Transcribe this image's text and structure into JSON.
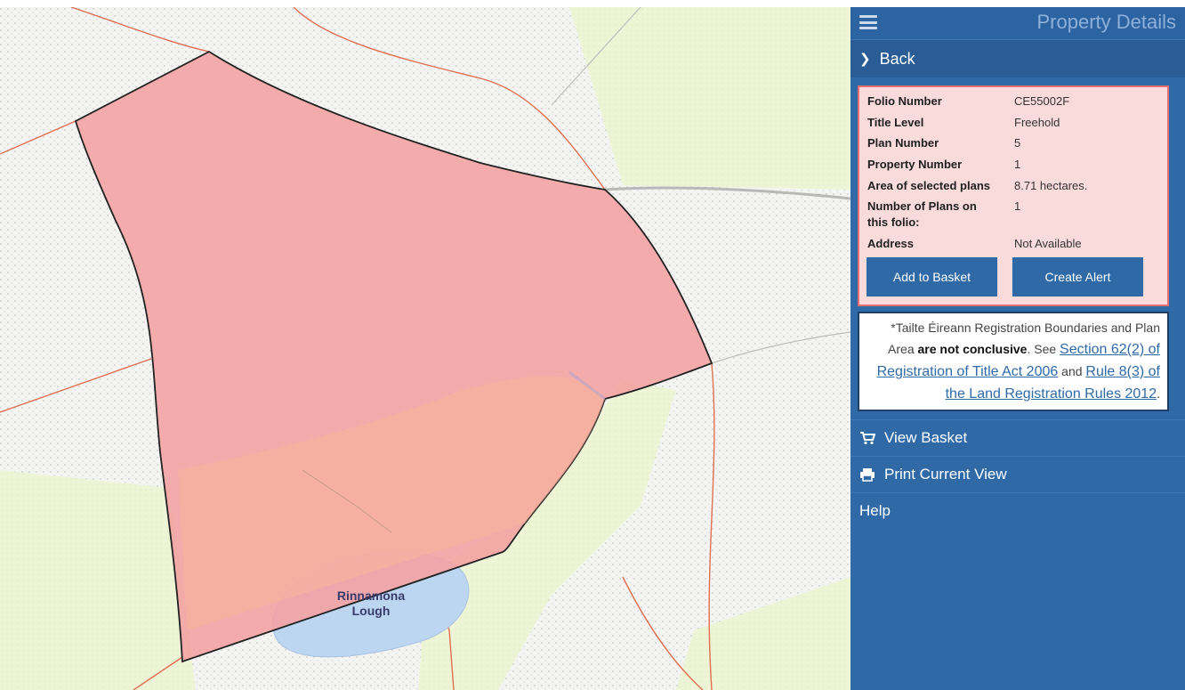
{
  "map": {
    "lake_label_line1": "Rinnamona",
    "lake_label_line2": "Lough"
  },
  "panel": {
    "title": "Property Details",
    "back_label": "Back",
    "details": {
      "folio_number_label": "Folio Number",
      "folio_number_value": "CE55002F",
      "title_level_label": "Title Level",
      "title_level_value": "Freehold",
      "plan_number_label": "Plan Number",
      "plan_number_value": "5",
      "property_number_label": "Property Number",
      "property_number_value": "1",
      "area_label": "Area of selected plans",
      "area_value": "8.71 hectares.",
      "num_plans_label_line1": "Number of Plans on",
      "num_plans_label_line2": "this folio:",
      "num_plans_value": "1",
      "address_label": "Address",
      "address_value": "Not Available",
      "add_to_basket_label": "Add to Basket",
      "create_alert_label": "Create Alert"
    },
    "notice": {
      "text1": "*Tailte Éireann Registration Boundaries and Plan",
      "text2": "Area",
      "bold": "are not conclusive",
      "text3": ". See",
      "link1": "Section 62(2) of Registration of Title Act 2006",
      "text4": "and",
      "link2": "Rule 8(3) of the Land Registration Rules 2012",
      "text5": "."
    },
    "menu": {
      "view_basket": "View Basket",
      "print_view": "Print Current View",
      "help": "Help"
    }
  },
  "colors": {
    "panel_bg": "#2f6aa7",
    "parcel_fill": "#f4a3a3",
    "parcel_border": "#222222",
    "lake_fill": "#b8d4f0",
    "road": "#e07050",
    "grass": "#eef5d8"
  }
}
